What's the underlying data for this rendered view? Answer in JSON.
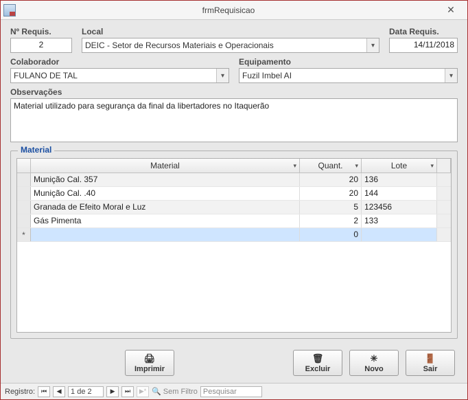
{
  "window": {
    "title": "frmRequisicao"
  },
  "labels": {
    "n_requis": "Nº Requis.",
    "local": "Local",
    "data_requis": "Data Requis.",
    "colaborador": "Colaborador",
    "equipamento": "Equipamento",
    "observacoes": "Observações",
    "material_group": "Material"
  },
  "fields": {
    "n_requis": "2",
    "local": "DEIC -  Setor de Recursos Materiais e Operacionais",
    "data_requis": "14/11/2018",
    "colaborador": "FULANO DE TAL",
    "equipamento": "Fuzil Imbel AI",
    "observacoes": "Material utilizado para segurança da final da libertadores no Itaquerão"
  },
  "grid": {
    "headers": {
      "material": "Material",
      "quant": "Quant.",
      "lote": "Lote"
    },
    "rows": [
      {
        "material": "Munição Cal. 357",
        "quant": "20",
        "lote": "136"
      },
      {
        "material": "Munição Cal. .40",
        "quant": "20",
        "lote": "144"
      },
      {
        "material": "Granada de Efeito Moral e Luz",
        "quant": "5",
        "lote": "123456"
      },
      {
        "material": "Gás Pimenta",
        "quant": "2",
        "lote": "133"
      }
    ],
    "newrow": {
      "material": "",
      "quant": "0",
      "lote": ""
    }
  },
  "buttons": {
    "imprimir": "Imprimir",
    "excluir": "Excluir",
    "novo": "Novo",
    "sair": "Sair"
  },
  "recordnav": {
    "label": "Registro:",
    "pos": "1 de 2",
    "nofilter": "Sem Filtro",
    "search": "Pesquisar"
  }
}
